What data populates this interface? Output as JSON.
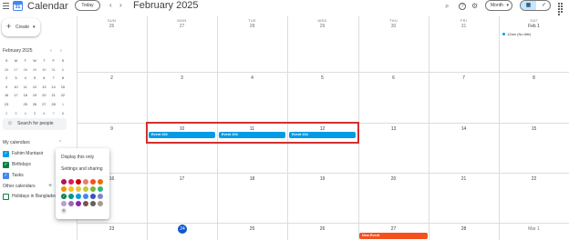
{
  "header": {
    "app_title": "Calendar",
    "logo_text": "31",
    "today_label": "Today",
    "prev_icon": "‹",
    "next_icon": "›",
    "period": "February 2025",
    "search_icon": "⌕",
    "help_icon": "?",
    "settings_icon": "⚙",
    "view_label": "Month",
    "view_caret": "▾",
    "calendar_toggle_icon": "▦",
    "tasks_toggle_icon": "✓"
  },
  "sidebar": {
    "create_label": "Create",
    "create_plus": "+",
    "create_caret": "▾",
    "mini_title": "February 2025",
    "mini_prev": "‹",
    "mini_next": "›",
    "mini_weekdays": [
      "S",
      "M",
      "T",
      "W",
      "T",
      "F",
      "S"
    ],
    "mini_weeks": [
      [
        "26",
        "27",
        "28",
        "29",
        "30",
        "31",
        "1"
      ],
      [
        "2",
        "3",
        "4",
        "5",
        "6",
        "7",
        "8"
      ],
      [
        "9",
        "10",
        "11",
        "12",
        "13",
        "14",
        "15"
      ],
      [
        "16",
        "17",
        "18",
        "19",
        "20",
        "21",
        "22"
      ],
      [
        "23",
        "24",
        "25",
        "26",
        "27",
        "28",
        "1"
      ],
      [
        "2",
        "3",
        "4",
        "5",
        "6",
        "7",
        "8"
      ]
    ],
    "search_people_placeholder": "Search for people",
    "search_people_icon": "☺",
    "my_calendars_title": "My calendars",
    "my_calendars_caret": "⌃",
    "my_calendars": [
      {
        "name": "Fahim Muntasir",
        "color": "#039be5",
        "checked": true
      },
      {
        "name": "Birthdays",
        "color": "#0b8043",
        "checked": true
      },
      {
        "name": "Tasks",
        "color": "#4285f4",
        "checked": true
      }
    ],
    "other_calendars_title": "Other calendars",
    "other_calendars_plus": "+",
    "other_calendars": [
      {
        "name": "Holidays in Bangladesh",
        "color": "#0b8043",
        "checked": false
      }
    ],
    "checkmark": "✓"
  },
  "popup": {
    "display_only": "Display this only",
    "settings_sharing": "Settings and sharing",
    "swatch_colors": [
      "#ad1457",
      "#d81b60",
      "#d50000",
      "#e67c73",
      "#f4511e",
      "#ef6c00",
      "#f09300",
      "#f6bf26",
      "#e4c441",
      "#c0ca33",
      "#7cb342",
      "#33b679",
      "#0b8043",
      "#009688",
      "#039be5",
      "#4285f4",
      "#3f51b5",
      "#7986cb",
      "#b39ddb",
      "#9e69af",
      "#8e24aa",
      "#795548",
      "#616161",
      "#a79b8e"
    ],
    "selected_swatch": "#0b8043",
    "add_color_symbol": "+"
  },
  "grid": {
    "weekdays": [
      "SUN",
      "MON",
      "TUE",
      "WED",
      "THU",
      "FRI",
      "SAT"
    ],
    "weeks": [
      [
        "26",
        "27",
        "28",
        "29",
        "30",
        "31",
        "Feb 1"
      ],
      [
        "2",
        "3",
        "4",
        "5",
        "6",
        "7",
        "8"
      ],
      [
        "9",
        "10",
        "11",
        "12",
        "13",
        "14",
        "15"
      ],
      [
        "16",
        "17",
        "18",
        "19",
        "20",
        "21",
        "22"
      ],
      [
        "23",
        "24",
        "25",
        "26",
        "27",
        "28",
        "Mar 1"
      ]
    ],
    "today": "24",
    "events": [
      {
        "title": "Event 102",
        "color": "#039be5"
      },
      {
        "title": "Event 103",
        "color": "#039be5"
      },
      {
        "title": "Event 104",
        "color": "#039be5"
      },
      {
        "title": "New Event",
        "color": "#f4511e"
      }
    ],
    "dot_event": {
      "title": "12am (No title)",
      "color": "#039be5"
    },
    "highlight_color": "#d32f2f"
  }
}
